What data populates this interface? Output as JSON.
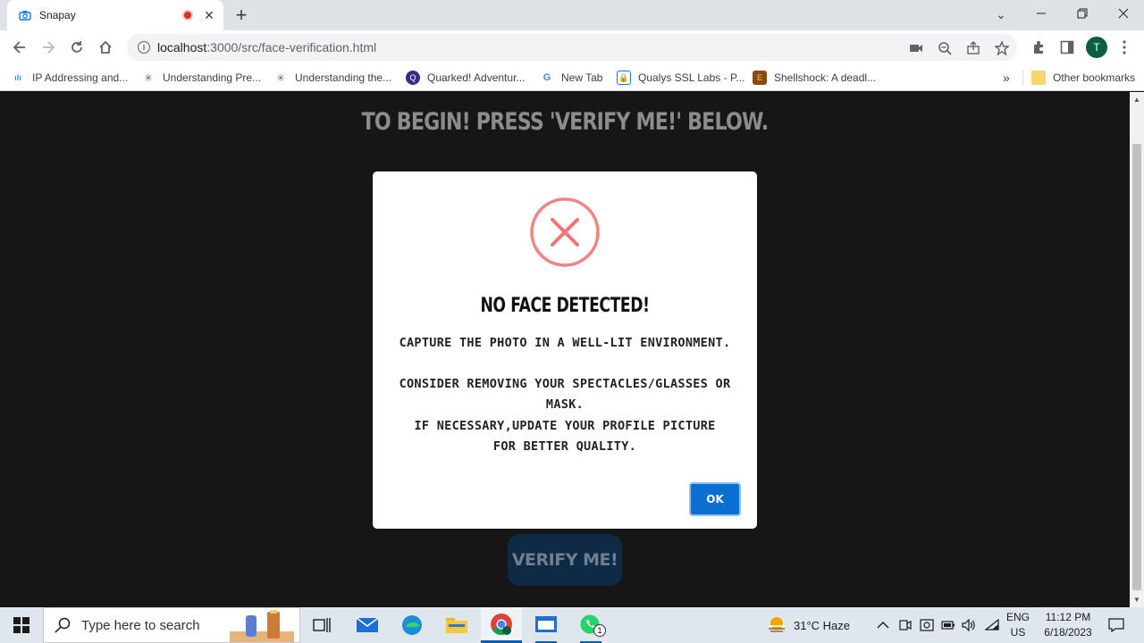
{
  "browser": {
    "tab_title": "Snapay",
    "url_host": "localhost",
    "url_rest": ":3000/src/face-verification.html",
    "avatar_letter": "T",
    "bookmarks": [
      {
        "label": "IP Addressing and..."
      },
      {
        "label": "Understanding Pre..."
      },
      {
        "label": "Understanding the..."
      },
      {
        "label": "Quarked! Adventur..."
      },
      {
        "label": "New Tab"
      },
      {
        "label": "Qualys SSL Labs - P..."
      },
      {
        "label": "Shellshock: A deadl..."
      }
    ],
    "overflow_label": "»",
    "other_bookmarks": "Other bookmarks"
  },
  "page": {
    "headline": "TO BEGIN! PRESS 'VERIFY ME!' BELOW.",
    "verify_button": "VERIFY ME!"
  },
  "modal": {
    "title": "NO FACE DETECTED!",
    "line1": "CAPTURE THE PHOTO IN A WELL-LIT ENVIRONMENT.",
    "line2": "CONSIDER REMOVING YOUR SPECTACLES/GLASSES OR MASK.",
    "line3": "IF NECESSARY,UPDATE YOUR PROFILE PICTURE FOR BETTER QUALITY.",
    "ok_label": "OK",
    "error_color": "#f27474",
    "button_color": "#0a6fd0"
  },
  "taskbar": {
    "search_placeholder": "Type here to search",
    "weather": "31°C  Haze",
    "lang_line1": "ENG",
    "lang_line2": "US",
    "time": "11:12 PM",
    "date": "6/18/2023",
    "whatsapp_badge": "1"
  }
}
